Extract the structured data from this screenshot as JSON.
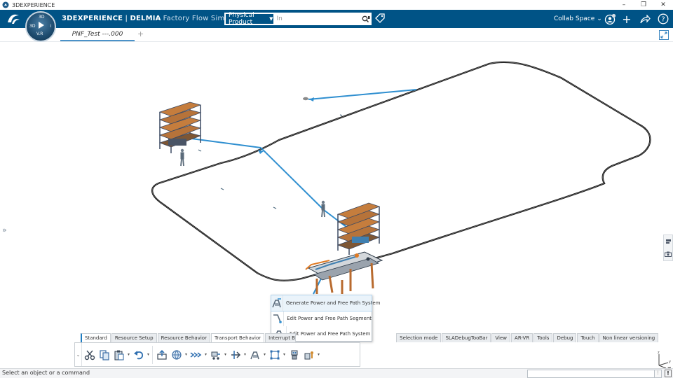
{
  "window": {
    "title": "3DEXPERIENCE",
    "controls": [
      "–",
      "❐",
      "✕"
    ]
  },
  "header": {
    "brand_3dx": "3DEXPERIENCE",
    "brand_sep": " | ",
    "brand_app": "DELMIA",
    "brand_sub": "Factory Flow Simulation",
    "search_scope": "Physical Product",
    "search_value": "In",
    "collab_space": "Collab Space",
    "compass": {
      "top": "3D",
      "left": "3D",
      "right": "i",
      "bottom": "V.R"
    }
  },
  "tabs": [
    {
      "label": "PNF_Test ---.000"
    }
  ],
  "context_menu": [
    {
      "label": "Generate Power and Free Path System",
      "icon": "generate-path-icon"
    },
    {
      "label": "Edit Power and Free Path Segment",
      "icon": "edit-segment-icon"
    },
    {
      "label": "Edit Power and Free Path System",
      "icon": "edit-system-icon"
    }
  ],
  "action_bar_tabs": [
    {
      "label": "Standard"
    },
    {
      "label": "Resource Setup"
    },
    {
      "label": "Resource Behavior"
    },
    {
      "label": "Transport Behavior"
    },
    {
      "label": "Interrupt Beh"
    },
    {
      "label": "Selection mode"
    },
    {
      "label": "SLADebugTooBar"
    },
    {
      "label": "View"
    },
    {
      "label": "AR-VR"
    },
    {
      "label": "Tools"
    },
    {
      "label": "Debug"
    },
    {
      "label": "Touch"
    },
    {
      "label": "Non linear versioning"
    }
  ],
  "status": {
    "message": "Select an object or a command"
  },
  "colors": {
    "header": "#005386",
    "path_blue": "#2f8fd0",
    "loop": "#1a1a1a"
  }
}
